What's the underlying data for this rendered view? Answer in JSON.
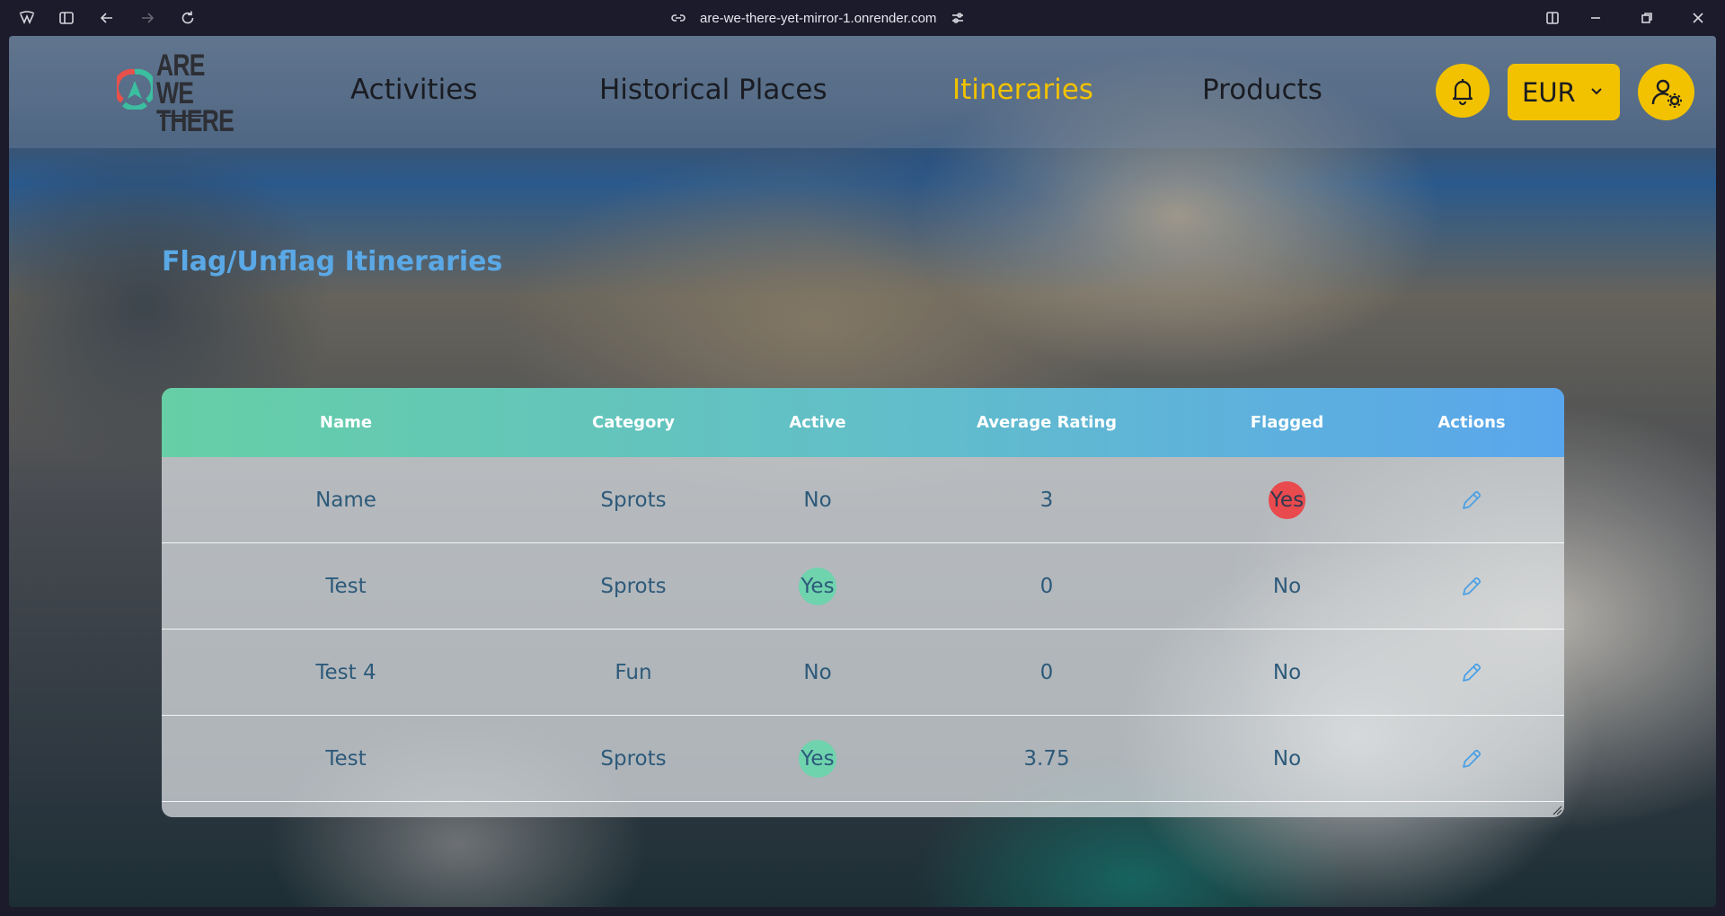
{
  "browser": {
    "url": "are-we-there-yet-mirror-1.onrender.com"
  },
  "brand": {
    "logo_line1": "ARE WE",
    "logo_line2": "THERE",
    "logo_colors": [
      "#e8514a",
      "#3bbfa0"
    ]
  },
  "nav": {
    "links": [
      {
        "label": "Activities",
        "active": false
      },
      {
        "label": "Historical Places",
        "active": false
      },
      {
        "label": "Itineraries",
        "active": true
      },
      {
        "label": "Products",
        "active": false
      }
    ],
    "currency": "EUR",
    "accent": "#f2c200"
  },
  "page": {
    "title": "Flag/Unflag Itineraries"
  },
  "table": {
    "headers": [
      "Name",
      "Category",
      "Active",
      "Average Rating",
      "Flagged",
      "Actions"
    ],
    "rows": [
      {
        "name": "Name",
        "category": "Sprots",
        "active": "No",
        "rating": "3",
        "flagged": "Yes"
      },
      {
        "name": "Test",
        "category": "Sprots",
        "active": "Yes",
        "rating": "0",
        "flagged": "No"
      },
      {
        "name": "Test 4",
        "category": "Fun",
        "active": "No",
        "rating": "0",
        "flagged": "No"
      },
      {
        "name": "Test",
        "category": "Sprots",
        "active": "Yes",
        "rating": "3.75",
        "flagged": "No"
      }
    ],
    "action_icon": "pencil-icon"
  }
}
